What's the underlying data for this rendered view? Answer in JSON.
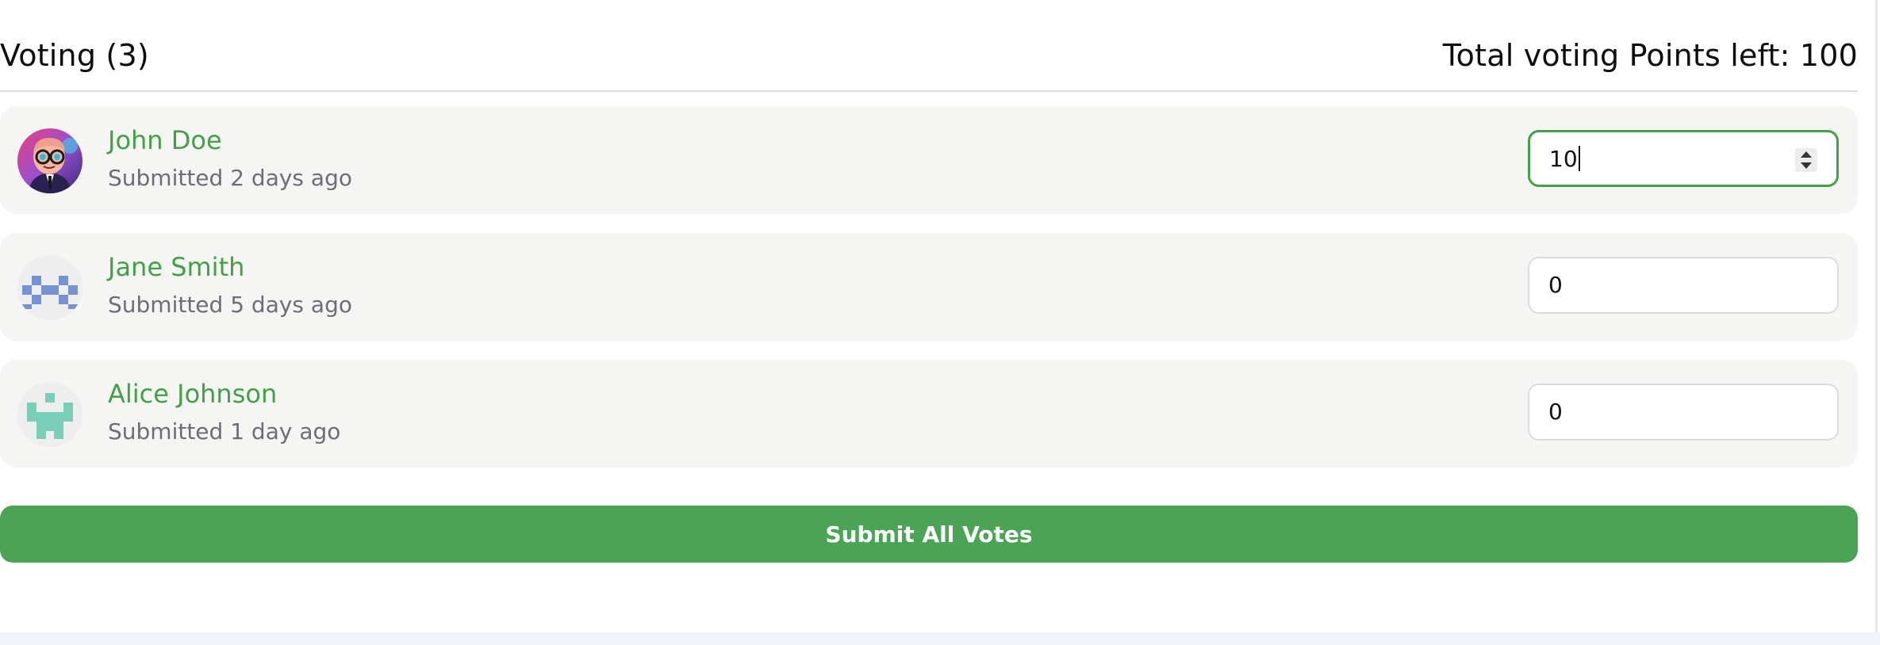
{
  "voting": {
    "title": "Voting (3)",
    "points_left": "Total voting Points left: 100"
  },
  "submissions": [
    {
      "name": "John Doe",
      "submitted": "Submitted 2 days ago",
      "points": "10",
      "avatar": "cartoon-avatar"
    },
    {
      "name": "Jane Smith",
      "submitted": "Submitted 5 days ago",
      "points": "0",
      "avatar": "identicon-blue"
    },
    {
      "name": "Alice Johnson",
      "submitted": "Submitted 1 day ago",
      "points": "0",
      "avatar": "identicon-teal"
    }
  ],
  "submit_button": {
    "label": "Submit All Votes"
  },
  "colors": {
    "accent": "#43a047",
    "button": "#4ba455",
    "card_bg": "#f5f6f4",
    "identicon_blue": "#7592d1",
    "identicon_teal": "#79ceb8"
  }
}
